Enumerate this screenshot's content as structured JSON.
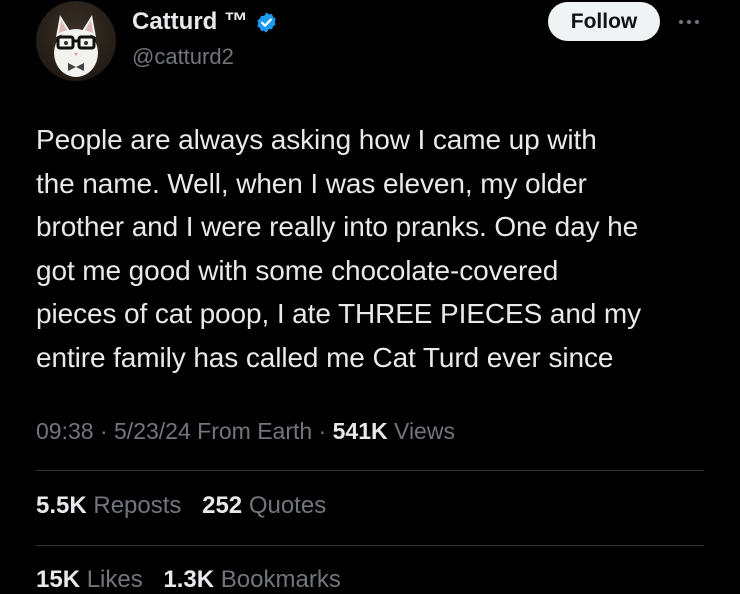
{
  "author": {
    "display_name": "Catturd ™",
    "handle": "@catturd2",
    "verified": true
  },
  "follow_button": {
    "label": "Follow"
  },
  "more_icon": "more-horizontal-icon",
  "tweet": {
    "text": "People are always asking how I came up with\nthe name. Well, when I was eleven, my older\nbrother and I were really into pranks. One day he\ngot me good with some chocolate-covered\npieces of cat poop, I ate THREE PIECES and my\nentire family has called me Cat Turd ever since"
  },
  "meta": {
    "time": "09:38",
    "separator": "·",
    "date": "5/23/24",
    "source": "From Earth",
    "views_count": "541K",
    "views_label": "Views"
  },
  "stats": {
    "reposts_count": "5.5K",
    "reposts_label": "Reposts",
    "quotes_count": "252",
    "quotes_label": "Quotes",
    "likes_count": "15K",
    "likes_label": "Likes",
    "bookmarks_count": "1.3K",
    "bookmarks_label": "Bookmarks"
  },
  "colors": {
    "background": "#000000",
    "text_primary": "#e7e9ea",
    "text_secondary": "#71767b",
    "verified_blue": "#1d9bf0",
    "divider": "#2f3336",
    "follow_bg": "#eff3f4"
  }
}
